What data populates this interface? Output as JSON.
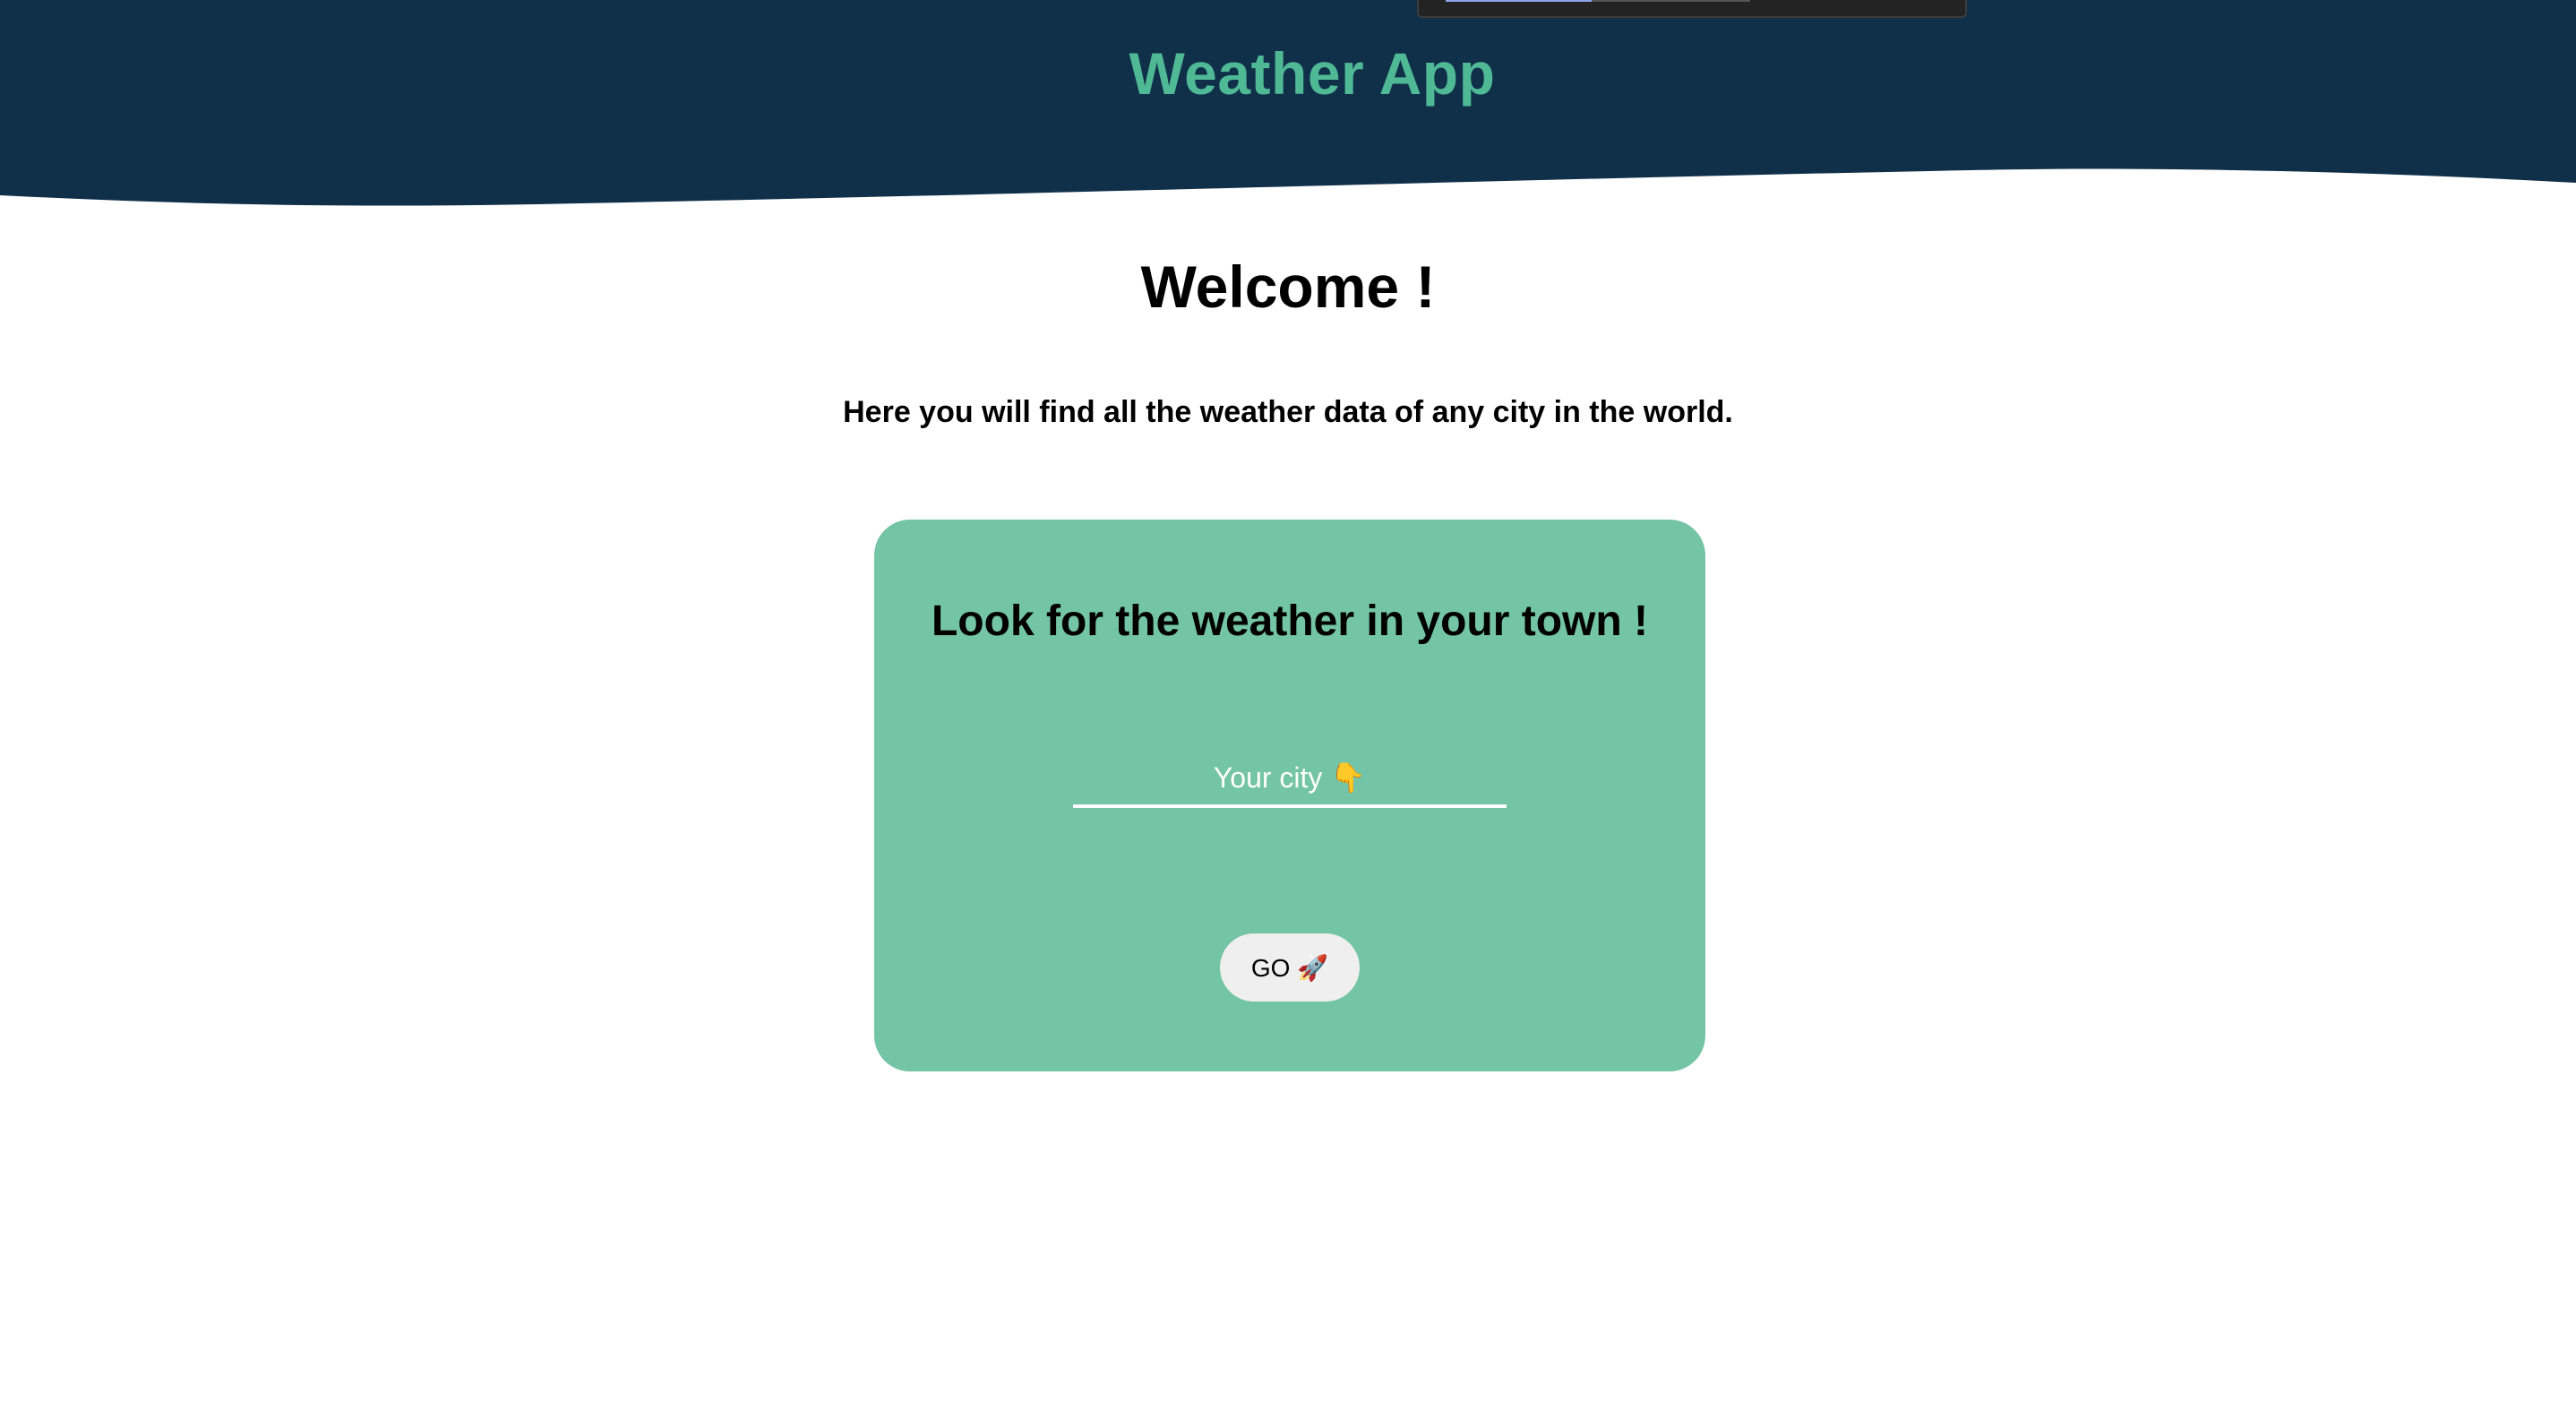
{
  "header": {
    "title": "Weather App",
    "background_color": "#10304a",
    "title_color": "#4fb895"
  },
  "top_overlay": {
    "progress_fraction": 0.48,
    "progress_color": "#8ea4ea"
  },
  "main": {
    "welcome": "Welcome !",
    "intro": "Here you will find all the weather data of any city in the world."
  },
  "search_card": {
    "background_color": "#74c4a7",
    "heading": "Look for the weather in your town !",
    "city_input": {
      "placeholder": "Your city 👇",
      "value": ""
    },
    "go_button_label": "GO 🚀"
  }
}
